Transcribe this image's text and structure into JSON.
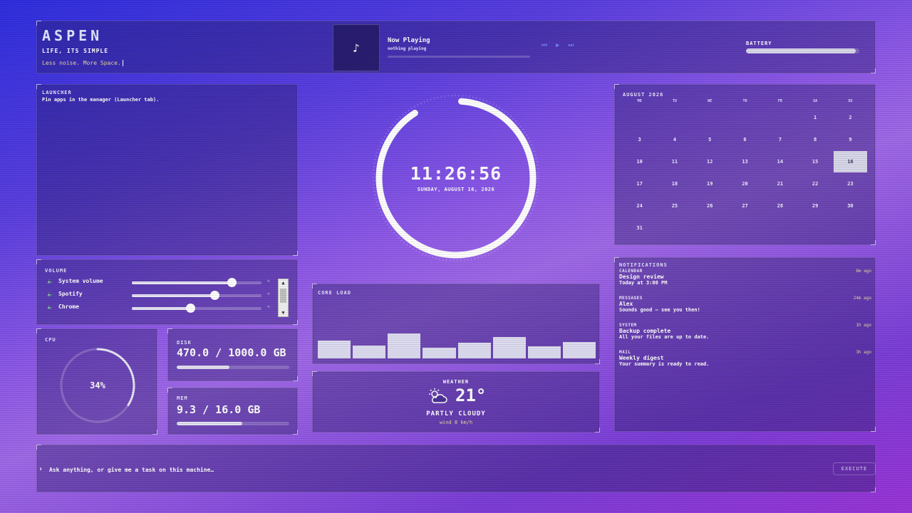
{
  "header": {
    "brand": "ASPEN",
    "tagline": "LIFE, ITS SIMPLE",
    "motto": "Less noise. More Space.",
    "now_playing": {
      "title": "Now Playing",
      "subtitle": "nothing playing",
      "album_icon": "music-note-icon",
      "progress_fraction": 0
    },
    "battery": {
      "label": "BATTERY",
      "level_fraction": 0.97
    }
  },
  "launcher": {
    "title": "LAUNCHER",
    "hint": "Pin apps in the manager (Launcher tab)."
  },
  "clock": {
    "time": "11:26:56",
    "date": "SUNDAY, AUGUST 16, 2026",
    "ring_icon": "clock-ring"
  },
  "volume": {
    "title": "VOLUME",
    "items": [
      {
        "label": "System volume",
        "icon": "speaker-icon",
        "level_fraction": 0.77
      },
      {
        "label": "Spotify",
        "icon": "speaker-icon",
        "level_fraction": 0.64
      },
      {
        "label": "Chrome",
        "icon": "speaker-icon",
        "level_fraction": 0.45
      }
    ]
  },
  "cpu": {
    "title": "CPU",
    "value": "34%",
    "fraction": 0.34
  },
  "disk": {
    "title": "DISK",
    "value": "470.0 / 1000.0 GB",
    "fraction": 0.47
  },
  "mem": {
    "title": "MEM",
    "value": "9.3 / 16.0 GB",
    "fraction": 0.58
  },
  "core_load": {
    "title": "CORE LOAD",
    "values": [
      0.68,
      0.5,
      0.95,
      0.4,
      0.6,
      0.8,
      0.45,
      0.63
    ]
  },
  "weather": {
    "title": "WEATHER",
    "temperature": "21°",
    "condition": "PARTLY CLOUDY",
    "wind": "wind 8 km/h",
    "icon": "partly-cloudy-icon"
  },
  "calendar": {
    "title": "AUGUST 2026",
    "weekdays": [
      "MO",
      "TU",
      "WE",
      "TH",
      "FR",
      "SA",
      "SU"
    ],
    "leading_blanks": 5,
    "days_in_month": 31,
    "today": 16
  },
  "notifications": {
    "title": "NOTIFICATIONS",
    "items": [
      {
        "app": "CALENDAR",
        "time": "8m ago",
        "title": "Design review",
        "body": "Today at 3:00 PM"
      },
      {
        "app": "MESSAGES",
        "time": "24m ago",
        "title": "Alex",
        "body": "Sounds good — see you then!"
      },
      {
        "app": "SYSTEM",
        "time": "1h ago",
        "title": "Backup complete",
        "body": "All your files are up to date."
      },
      {
        "app": "MAIL",
        "time": "3h ago",
        "title": "Weekly digest",
        "body": "Your summary is ready to read."
      }
    ]
  },
  "command": {
    "prompt": "›",
    "placeholder": "Ask anything, or give me a task on this machine…",
    "execute_label": "EXECUTE"
  },
  "colors": {
    "accent_gold": "#e8d79a",
    "panel_bg": "rgba(40,30,100,0.38)"
  }
}
